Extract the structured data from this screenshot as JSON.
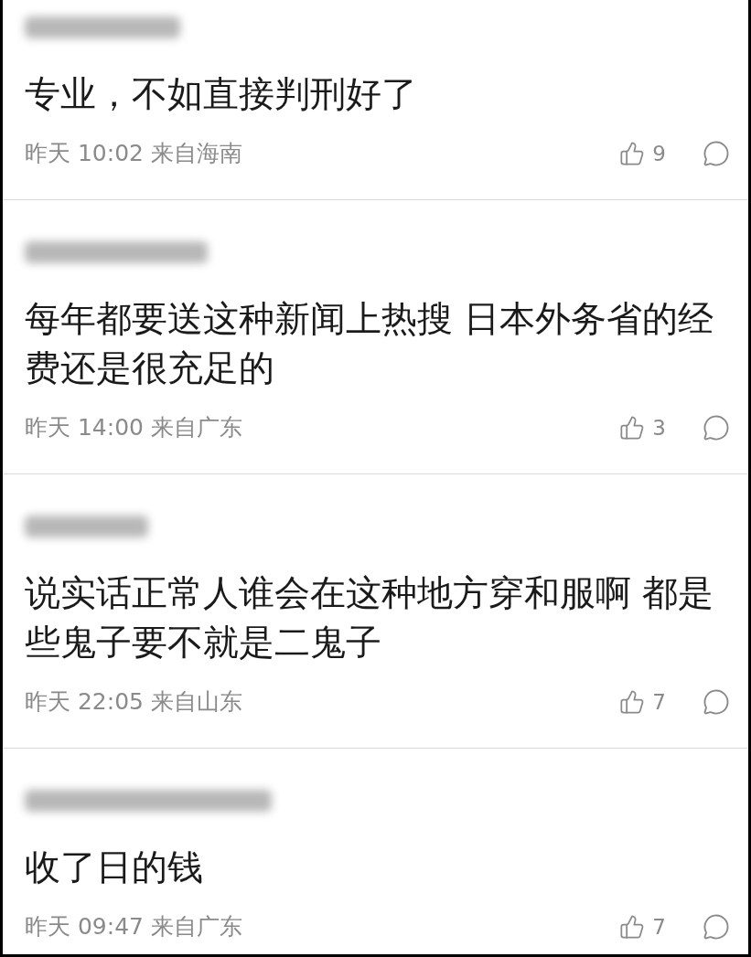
{
  "comments": [
    {
      "username_blurred": true,
      "text": "专业，不如直接判刑好了",
      "meta": "昨天 10:02 来自海南",
      "likes": "9"
    },
    {
      "username_blurred": true,
      "text": "每年都要送这种新闻上热搜 日本外务省的经费还是很充足的",
      "meta": "昨天 14:00 来自广东",
      "likes": "3"
    },
    {
      "username_blurred": true,
      "text": "说实话正常人谁会在这种地方穿和服啊 都是些鬼子要不就是二鬼子",
      "meta": "昨天 22:05 来自山东",
      "likes": "7"
    },
    {
      "username_blurred": true,
      "text": "收了日的钱",
      "meta": "昨天 09:47 来自广东",
      "likes": "7"
    }
  ]
}
